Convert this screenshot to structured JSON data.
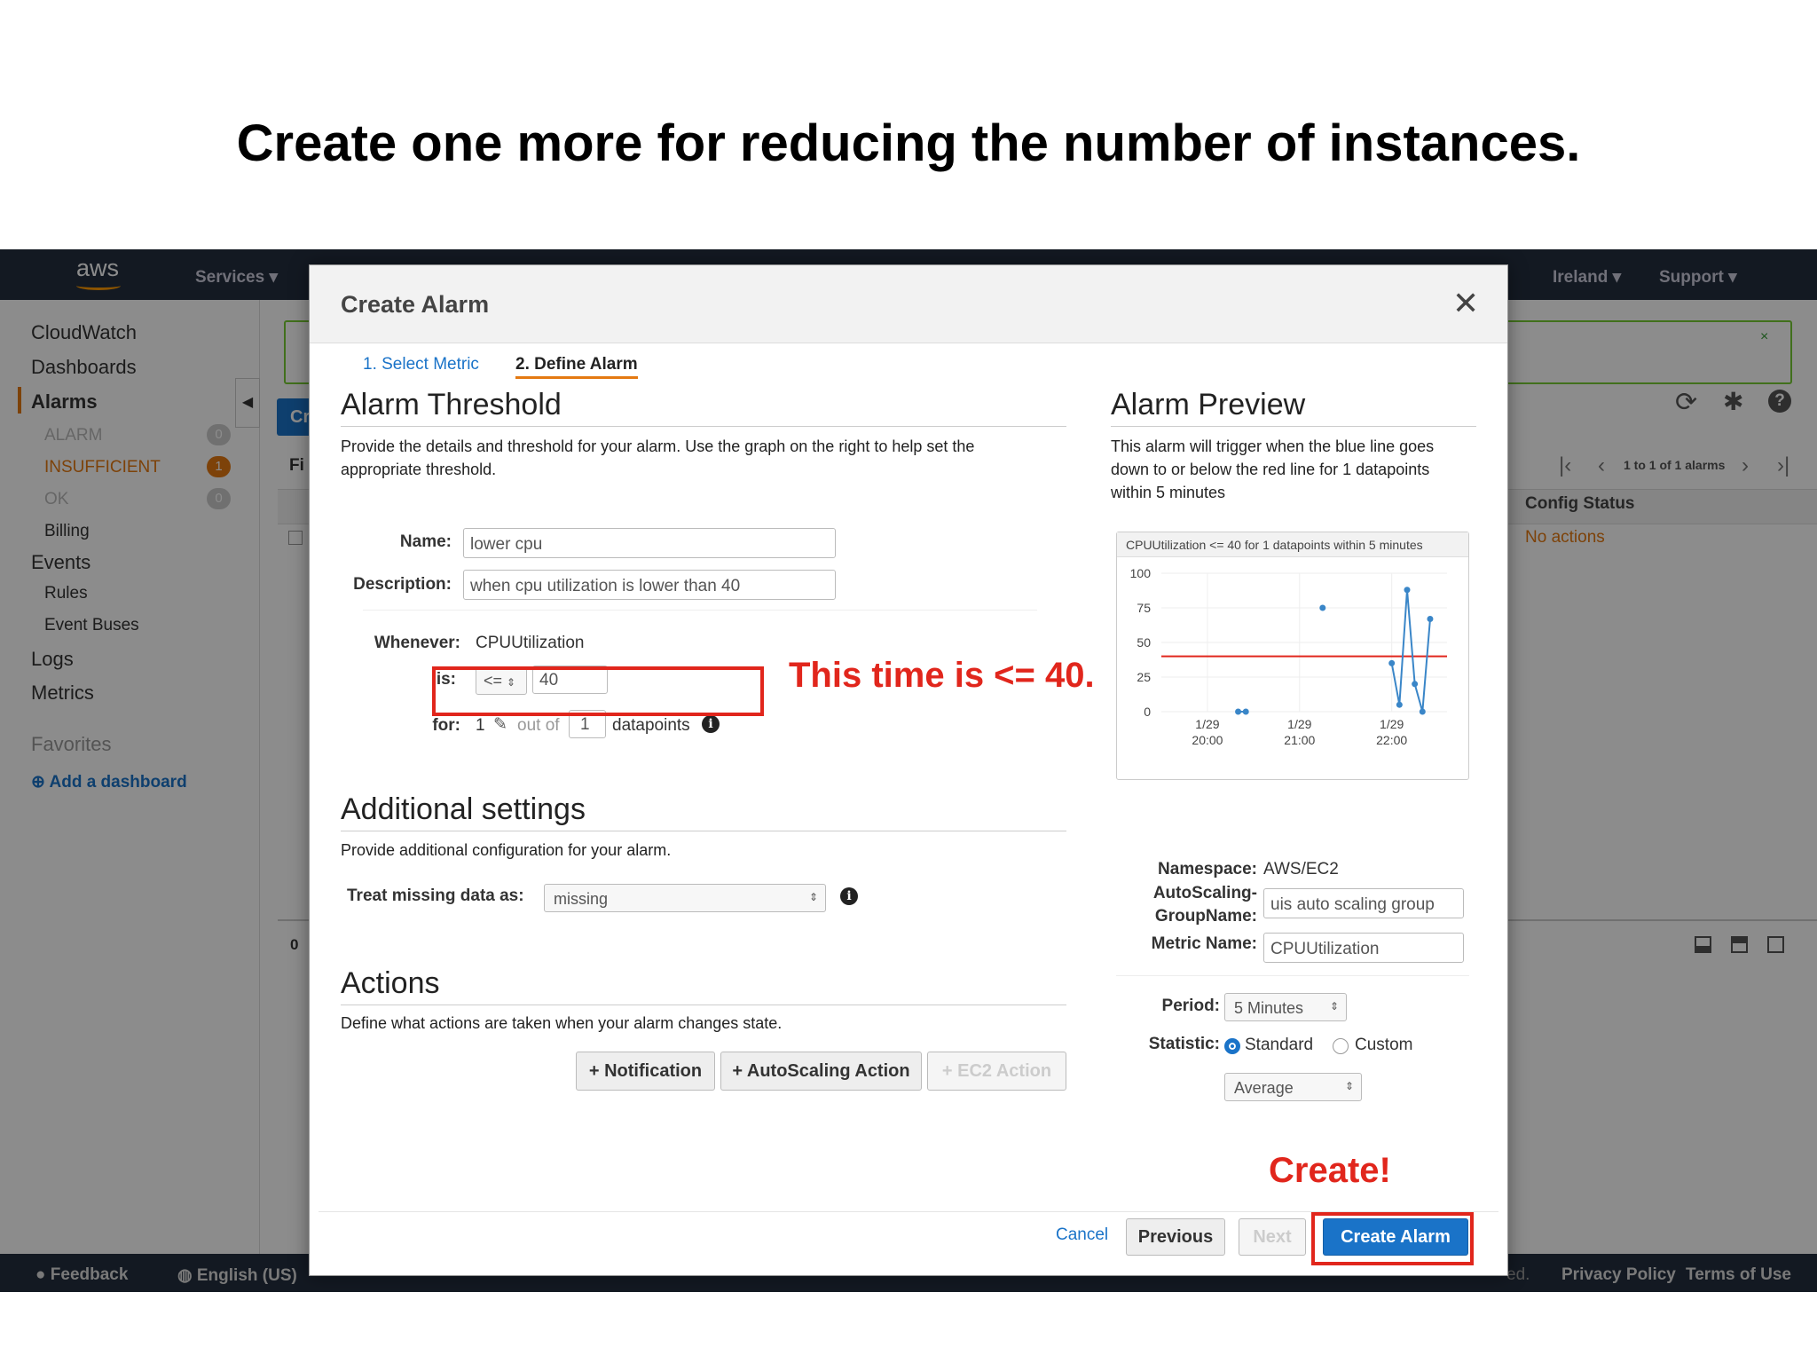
{
  "slide": {
    "title": "Create one more for reducing the number of instances."
  },
  "topnav": {
    "logo": "aws",
    "services": "Services",
    "region": "Ireland",
    "support": "Support"
  },
  "sidebar": {
    "items": [
      "CloudWatch",
      "Dashboards",
      "Alarms",
      "ALARM",
      "INSUFFICIENT",
      "OK",
      "Billing",
      "Events",
      "Rules",
      "Event Buses",
      "Logs",
      "Metrics",
      "Favorites",
      "Add a dashboard"
    ],
    "badges": {
      "alarm": "0",
      "insufficient": "1",
      "ok": "0"
    }
  },
  "background": {
    "create_fragment": "Cr",
    "filter_fragment": "Fi",
    "pager": "1 to 1 of 1 alarms",
    "config_status_header": "Config Status",
    "config_status_value": "No actions",
    "detail_fragment": "0"
  },
  "modal": {
    "title": "Create Alarm",
    "steps": [
      "1. Select Metric",
      "2. Define Alarm"
    ],
    "threshold": {
      "heading": "Alarm Threshold",
      "description": "Provide the details and threshold for your alarm. Use the graph on the right to help set the appropriate threshold.",
      "name_label": "Name:",
      "name_value": "lower cpu",
      "desc_label": "Description:",
      "desc_value": "when cpu utilization is lower than 40",
      "whenever_label": "Whenever:",
      "whenever_value": "CPUUtilization",
      "is_label": "is:",
      "operator": "<=",
      "threshold_value": "40",
      "for_label": "for:",
      "for_value": "1",
      "out_of": "out of",
      "datapoints_value": "1",
      "datapoints_label": "datapoints"
    },
    "additional": {
      "heading": "Additional settings",
      "description": "Provide additional configuration for your alarm.",
      "missing_label": "Treat missing data as:",
      "missing_value": "missing"
    },
    "actions": {
      "heading": "Actions",
      "description": "Define what actions are taken when your alarm changes state.",
      "buttons": [
        "+ Notification",
        "+ AutoScaling Action",
        "+ EC2 Action"
      ]
    },
    "preview": {
      "heading": "Alarm Preview",
      "description": "This alarm will trigger when the blue line goes down to or below the red line for 1 datapoints within 5 minutes",
      "namespace_label": "Namespace:",
      "namespace_value": "AWS/EC2",
      "asg_label_1": "AutoScaling-",
      "asg_label_2": "GroupName:",
      "asg_value": "uis auto scaling group",
      "metric_label": "Metric Name:",
      "metric_value": "CPUUtilization",
      "period_label": "Period:",
      "period_value": "5 Minutes",
      "statistic_label": "Statistic:",
      "standard": "Standard",
      "custom": "Custom",
      "statistic_value": "Average"
    },
    "footer": {
      "cancel": "Cancel",
      "previous": "Previous",
      "next": "Next",
      "create": "Create Alarm"
    }
  },
  "annotations": {
    "threshold_note": "This time is <= 40.",
    "create_note": "Create!"
  },
  "page_footer": {
    "feedback": "Feedback",
    "language": "English (US)",
    "copyright_tail": "ed.",
    "privacy": "Privacy Policy",
    "terms": "Terms of Use"
  },
  "colors": {
    "accent_red": "#e1261c",
    "nav_bg": "#232f3e",
    "primary_blue": "#1a73c8",
    "series_blue": "#3a86c8",
    "threshold_red": "#e1261c"
  },
  "chart_data": {
    "type": "line",
    "title": "CPUUtilization <= 40 for 1 datapoints within 5 minutes",
    "x_ticks": [
      "1/29 20:00",
      "1/29 21:00",
      "1/29 22:00"
    ],
    "y_ticks": [
      0,
      25,
      50,
      75,
      100
    ],
    "ylim": [
      0,
      100
    ],
    "threshold": 40,
    "series": [
      {
        "segments": [
          {
            "x": [
              "1/29 20:20",
              "1/29 20:25"
            ],
            "y": [
              0,
              0
            ]
          },
          {
            "x": [
              "1/29 21:15"
            ],
            "y": [
              75
            ]
          },
          {
            "x": [
              "1/29 22:00",
              "1/29 22:05",
              "1/29 22:10",
              "1/29 22:15",
              "1/29 22:20",
              "1/29 22:25"
            ],
            "y": [
              35,
              5,
              88,
              20,
              0,
              67
            ]
          }
        ]
      }
    ]
  }
}
